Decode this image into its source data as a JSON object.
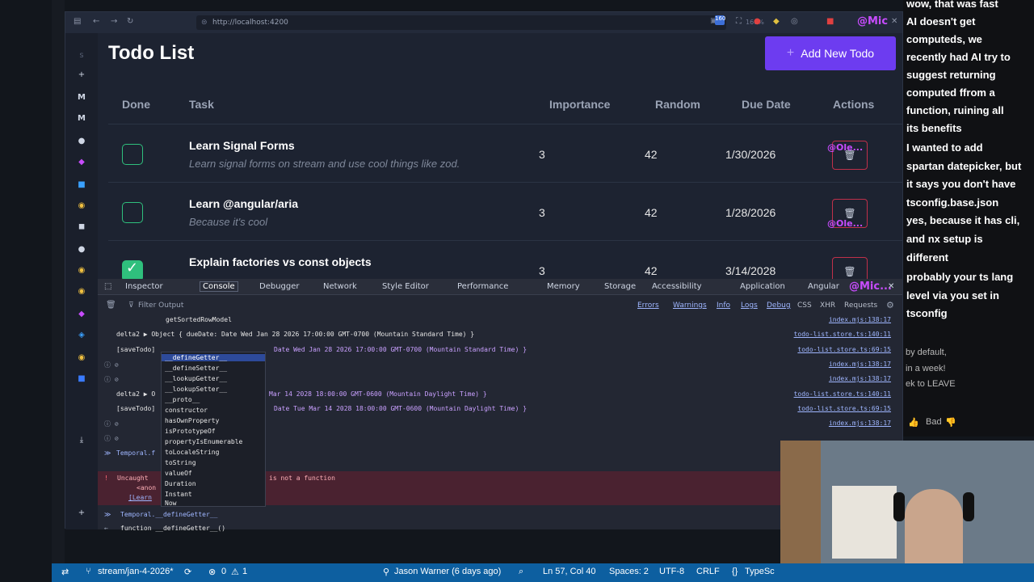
{
  "browser": {
    "url": "http://localhost:4200",
    "zoom": "160%"
  },
  "app": {
    "title": "Todo List",
    "add_button": "Add New Todo",
    "columns": [
      "Done",
      "Task",
      "Importance",
      "Random",
      "Due Date",
      "Actions"
    ],
    "todos": [
      {
        "done": false,
        "title": "Learn Signal Forms",
        "desc": "Learn signal forms on stream and use cool things like zod.",
        "importance": "3",
        "random": "42",
        "due": "1/30/2026"
      },
      {
        "done": false,
        "title": "Learn @angular/aria",
        "desc": "Because it's cool",
        "importance": "3",
        "random": "42",
        "due": "1/28/2026"
      },
      {
        "done": true,
        "title": "Explain factories vs const objects",
        "desc": "",
        "importance": "3",
        "random": "42",
        "due": "3/14/2028"
      }
    ],
    "overlay_handle": "@Mic",
    "overlay_handle2": "@Ole...",
    "overlay_handle3": "@Mic..."
  },
  "devtools": {
    "tabs": [
      "Inspector",
      "Console",
      "Debugger",
      "Network",
      "Style Editor",
      "Performance",
      "Memory",
      "Storage",
      "Accessibility",
      "Application",
      "Angular"
    ],
    "active_tab": "Console",
    "filter_placeholder": "Filter Output",
    "levels": [
      "Errors",
      "Warnings",
      "Info",
      "Logs",
      "Debug"
    ],
    "extra_filters": [
      "CSS",
      "XHR",
      "Requests"
    ],
    "logs": [
      {
        "text": "getSortedRowModel",
        "src": "index.mjs:138:17"
      },
      {
        "text": "delta2 ▶ Object { dueDate: Date Wed Jan 28 2026 17:00:00 GMT-0700 (Mountain Standard Time) }",
        "src": "todo-list.store.ts:140:11"
      },
      {
        "text": "[saveTodo]",
        "tail": "Date Wed Jan 28 2026 17:00:00 GMT-0700 (Mountain Standard Time) }",
        "src": "todo-list.store.ts:69:15"
      },
      {
        "text": "",
        "src": "index.mjs:138:17"
      },
      {
        "text": "",
        "src": "index.mjs:138:17"
      },
      {
        "text": "delta2 ▶ O",
        "tail": "Mar 14 2028 18:00:00 GMT-0600 (Mountain Daylight Time) }",
        "src": "todo-list.store.ts:140:11"
      },
      {
        "text": "[saveTodo]",
        "tail": "Date Tue Mar 14 2028 18:00:00 GMT-0600 (Mountain Daylight Time) }",
        "src": "todo-list.store.ts:69:15"
      },
      {
        "text": "",
        "src": "index.mjs:138:17"
      }
    ],
    "temporal_prompt": "Temporal.f",
    "error_text": "Uncaught",
    "error_tail": "is not a function",
    "error_anon": "<anon",
    "error_learn": "[Learn",
    "autocomplete": [
      "__defineGetter__",
      "__defineSetter__",
      "__lookupGetter__",
      "__lookupSetter__",
      "__proto__",
      "constructor",
      "hasOwnProperty",
      "isPrototypeOf",
      "propertyIsEnumerable",
      "toLocaleString",
      "toString",
      "valueOf",
      "Duration",
      "Instant",
      "Now"
    ],
    "input_line": "Temporal.__defineGetter__",
    "result_line": "function __defineGetter__()"
  },
  "chat": {
    "lines": [
      "wow, that was fast",
      "AI doesn't get",
      "computeds, we",
      "recently had AI try to",
      "suggest returning",
      "computed ffrom a",
      "function, ruining all",
      "its benefits",
      "I wanted to add",
      "spartan datepicker, but",
      "it says you don't have",
      "tsconfig.base.json",
      "yes, because it has cli,",
      "and nx setup is",
      "different",
      "probably your ts lang",
      "level via you set in",
      "tsconfig"
    ],
    "dim_lines": [
      "by default,",
      "in a week!",
      "ek to LEAVE"
    ],
    "bad_label": "Bad"
  },
  "statusbar": {
    "branch": "stream/jan-4-2026*",
    "problems": "0",
    "warnings": "1",
    "blame": "Jason Warner (6 days ago)",
    "position": "Ln 57, Col 40",
    "spaces": "Spaces: 2",
    "encoding": "UTF-8",
    "eol": "CRLF",
    "language": "TypeSc"
  }
}
